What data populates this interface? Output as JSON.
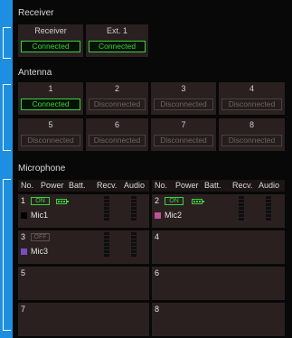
{
  "colors": {
    "accent": "#1e8fe0",
    "connected": "#39d13d",
    "disconnected": "#6d6464"
  },
  "receiver": {
    "title": "Receiver",
    "units": [
      {
        "label": "Receiver",
        "status": "Connected",
        "connected": true
      },
      {
        "label": "Ext. 1",
        "status": "Connected",
        "connected": true
      }
    ]
  },
  "antenna": {
    "title": "Antenna",
    "slots": [
      {
        "label": "1",
        "status": "Connected",
        "connected": true
      },
      {
        "label": "2",
        "status": "Disconnected",
        "connected": false
      },
      {
        "label": "3",
        "status": "Disconnected",
        "connected": false
      },
      {
        "label": "4",
        "status": "Disconnected",
        "connected": false
      },
      {
        "label": "5",
        "status": "Disconnected",
        "connected": false
      },
      {
        "label": "6",
        "status": "Disconnected",
        "connected": false
      },
      {
        "label": "7",
        "status": "Disconnected",
        "connected": false
      },
      {
        "label": "8",
        "status": "Disconnected",
        "connected": false
      }
    ]
  },
  "microphone": {
    "title": "Microphone",
    "columns": [
      "No.",
      "Power",
      "Batt.",
      "Recv.",
      "Audio"
    ],
    "slots": [
      {
        "no": "1",
        "power": "ON",
        "power_on": true,
        "battery": true,
        "name": "Mic1",
        "color": "#000000"
      },
      {
        "no": "2",
        "power": "ON",
        "power_on": true,
        "battery": true,
        "name": "Mic2",
        "color": "#c0509a"
      },
      {
        "no": "3",
        "power": "OFF",
        "power_on": false,
        "battery": false,
        "name": "Mic3",
        "color": "#7a4cc0"
      },
      {
        "no": "4"
      },
      {
        "no": "5"
      },
      {
        "no": "6"
      },
      {
        "no": "7"
      },
      {
        "no": "8"
      }
    ]
  }
}
